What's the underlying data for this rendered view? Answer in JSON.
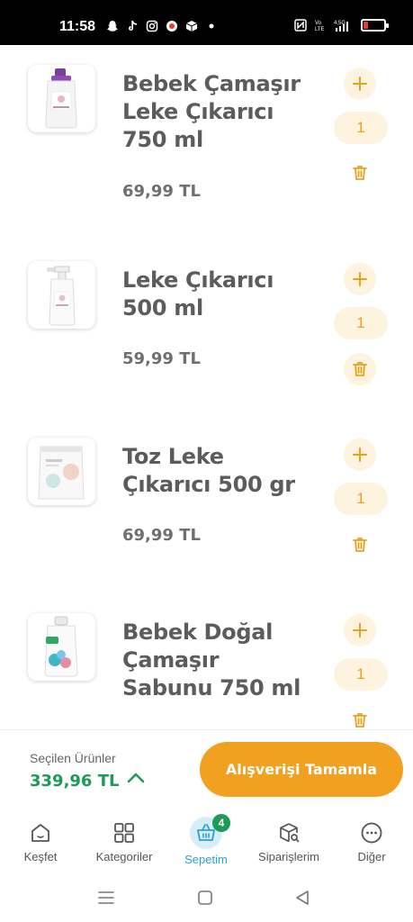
{
  "status_bar": {
    "time": "11:58",
    "network": "4,5G",
    "volte": "Vo LTE"
  },
  "cart_items": [
    {
      "name": "Bebek Çamaşır Leke Çıkarıcı 750 ml",
      "price": "69,99 TL",
      "quantity": "1"
    },
    {
      "name": "Leke Çıkarıcı 500 ml",
      "price": "59,99 TL",
      "quantity": "1"
    },
    {
      "name": "Toz Leke Çıkarıcı 500 gr",
      "price": "69,99 TL",
      "quantity": "1"
    },
    {
      "name": "Bebek Doğal Çamaşır Sabunu 750 ml",
      "price": "",
      "quantity": "1"
    }
  ],
  "checkout": {
    "selected_label": "Seçilen Ürünler",
    "total": "339,96 TL",
    "button_label": "Alışverişi Tamamla"
  },
  "bottom_nav": {
    "items": [
      {
        "label": "Keşfet",
        "icon": "home-icon"
      },
      {
        "label": "Kategoriler",
        "icon": "grid-icon"
      },
      {
        "label": "Sepetim",
        "icon": "basket-icon",
        "badge": "4",
        "active": true
      },
      {
        "label": "Siparişlerim",
        "icon": "package-search-icon"
      },
      {
        "label": "Diğer",
        "icon": "more-icon"
      }
    ]
  },
  "colors": {
    "accent": "#f2a020",
    "accent_light": "#fdf3df",
    "price_total": "#1c9a58",
    "active_nav": "#2aa0d8"
  }
}
